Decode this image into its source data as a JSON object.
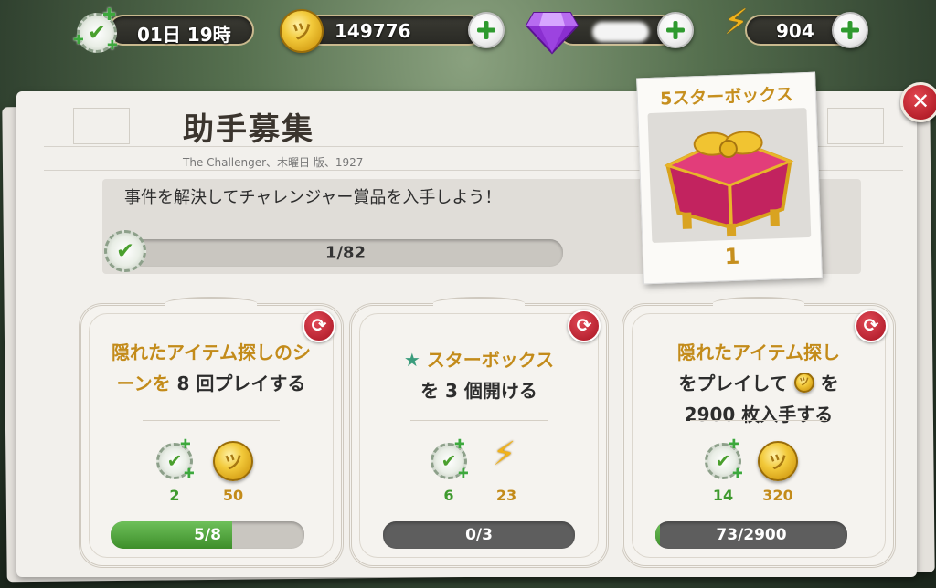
{
  "topbar": {
    "timer": "01日 19時",
    "coins": "149776",
    "gems": "",
    "energy": "904"
  },
  "panel": {
    "title": "助手募集",
    "subtitle": "The Challenger、木曜日 版、1927",
    "description": "事件を解決してチャレンジャー賞品を入手しよう！",
    "progress_text": "1/82",
    "progress_fraction": 0.012
  },
  "prize": {
    "title": "5スターボックス",
    "count": "1"
  },
  "cards": [
    {
      "task_gold": "隠れたアイテム探しのシーンを",
      "task_plain": " 8 回プレイする",
      "reward_check": "2",
      "reward_second": "50",
      "reward_second_icon": "coin-icon",
      "progress_text": "5/8",
      "progress_fraction": 0.625
    },
    {
      "task_gold": "スターボックス",
      "task_plain": "を 3 個開ける",
      "reward_check": "6",
      "reward_second": "23",
      "reward_second_icon": "lightning-icon",
      "progress_text": "0/3",
      "progress_fraction": 0.0
    },
    {
      "task_gold": "隠れたアイテム探し",
      "task_plain_a": "をプレイして",
      "task_plain_b": " を",
      "task_plain_c": "2900 枚入手する",
      "reward_check": "14",
      "reward_second": "320",
      "reward_second_icon": "coin-icon",
      "progress_text": "73/2900",
      "progress_fraction": 0.025
    }
  ],
  "colors": {
    "gold": "#c38b1a",
    "green": "#3f9a2e",
    "red": "#b81826"
  }
}
